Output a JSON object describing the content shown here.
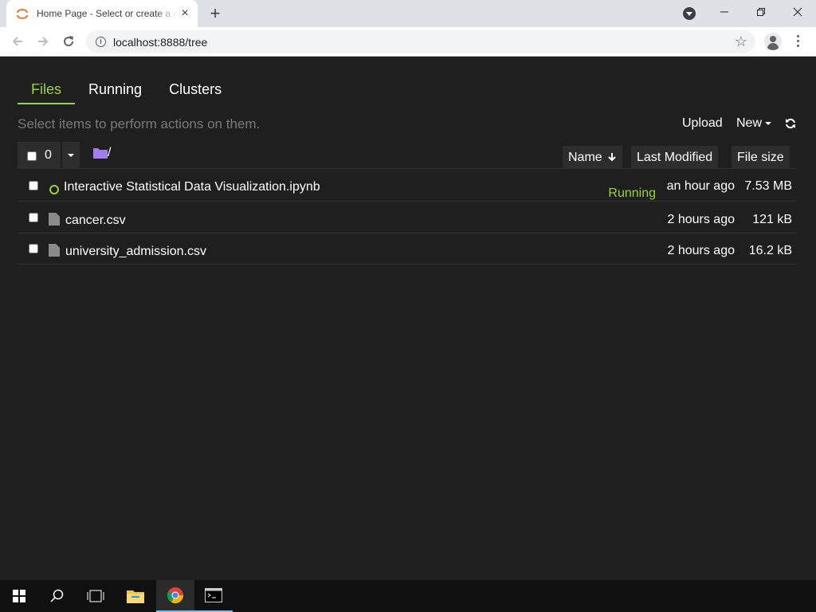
{
  "browser": {
    "tab_title": "Home Page - Select or create a notebook",
    "url": "localhost:8888/tree"
  },
  "jupyter": {
    "tabs": [
      {
        "label": "Files",
        "active": true
      },
      {
        "label": "Running",
        "active": false
      },
      {
        "label": "Clusters",
        "active": false
      }
    ],
    "hint": "Select items to perform actions on them.",
    "upload_label": "Upload",
    "new_label": "New",
    "selected_count": "0",
    "path": "/",
    "columns": {
      "name": "Name",
      "last_modified": "Last Modified",
      "file_size": "File size"
    },
    "files": [
      {
        "name": "Interactive Statistical Data Visualization.ipynb",
        "type": "notebook",
        "status": "Running",
        "modified": "an hour ago",
        "size": "7.53 MB"
      },
      {
        "name": "cancer.csv",
        "type": "file",
        "status": "",
        "modified": "2 hours ago",
        "size": "121 kB"
      },
      {
        "name": "university_admission.csv",
        "type": "file",
        "status": "",
        "modified": "2 hours ago",
        "size": "16.2 kB"
      }
    ]
  },
  "colors": {
    "accent": "#9bd33a",
    "background": "#1f1f1f",
    "folder": "#a47cf0"
  }
}
